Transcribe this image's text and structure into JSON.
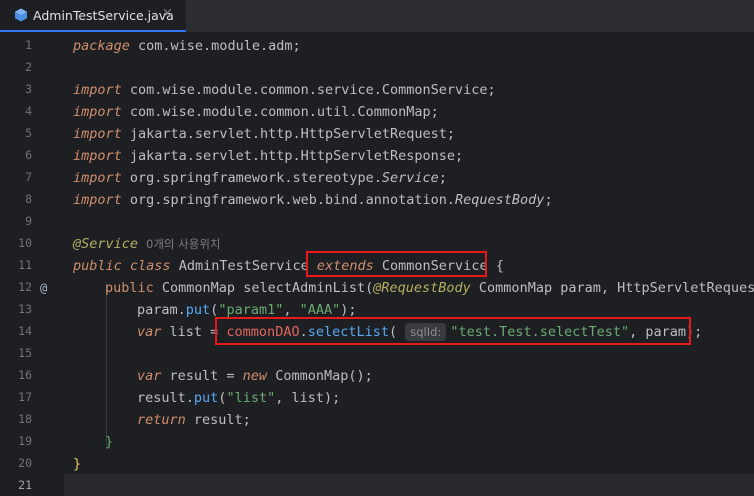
{
  "tab": {
    "filename": "AdminTestService.java",
    "close": "×"
  },
  "gutter": {
    "numbers": [
      "1",
      "2",
      "3",
      "4",
      "5",
      "6",
      "7",
      "8",
      "9",
      "10",
      "11",
      "12",
      "13",
      "14",
      "15",
      "16",
      "17",
      "18",
      "19",
      "20",
      "21"
    ],
    "marker": "@"
  },
  "code": {
    "l1_kw": "package",
    "l1_rest": " com.wise.module.adm;",
    "import_kw": "import",
    "l3": " com.wise.module.common.service.CommonService;",
    "l4": " com.wise.module.common.util.CommonMap;",
    "l5": " jakarta.servlet.http.HttpServletRequest;",
    "l6": " jakarta.servlet.http.HttpServletResponse;",
    "l7_a": " org.springframework.stereotype.",
    "l7_b": "Service",
    "l7_c": ";",
    "l8_a": " org.springframework.web.bind.annotation.",
    "l8_b": "RequestBody",
    "l8_c": ";",
    "l10_ann": "@Service",
    "l10_usages": "0개의 사용위치",
    "l11_public": "public",
    "l11_class": "class",
    "l11_name": " AdminTestService ",
    "l11_extends": "extends",
    "l11_super": " CommonService",
    "l11_brace": " {",
    "l12_public": "public",
    "l12_type": " CommonMap ",
    "l12_method": "selectAdminList",
    "l12_open": "(",
    "l12_ann": "@RequestBody",
    "l12_rest": " CommonMap param, HttpServletRequest",
    "l13_a": "param.",
    "l13_m": "put",
    "l13_b": "(",
    "l13_s1": "\"param1\"",
    "l13_c": ", ",
    "l13_s2": "\"AAA\"",
    "l13_d": ");",
    "l14_var": "var",
    "l14_a": " list = ",
    "l14_fld": "commonDAO",
    "l14_dot": ".",
    "l14_m": "selectList",
    "l14_open": "( ",
    "l14_hint": "sqlId:",
    "l14_s": "\"test.Test.selectTest\"",
    "l14_rest": ", param);",
    "l16_var": "var",
    "l16_a": " result = ",
    "l16_new": "new",
    "l16_b": " CommonMap();",
    "l17_a": "result.",
    "l17_m": "put",
    "l17_b": "(",
    "l17_s": "\"list\"",
    "l17_c": ", list);",
    "l18_kw": "return",
    "l18_a": " result;",
    "l19": "}",
    "l20": "}"
  },
  "colors": {
    "highlight_box": "#e8191b",
    "tab_accent": "#3574f0"
  }
}
